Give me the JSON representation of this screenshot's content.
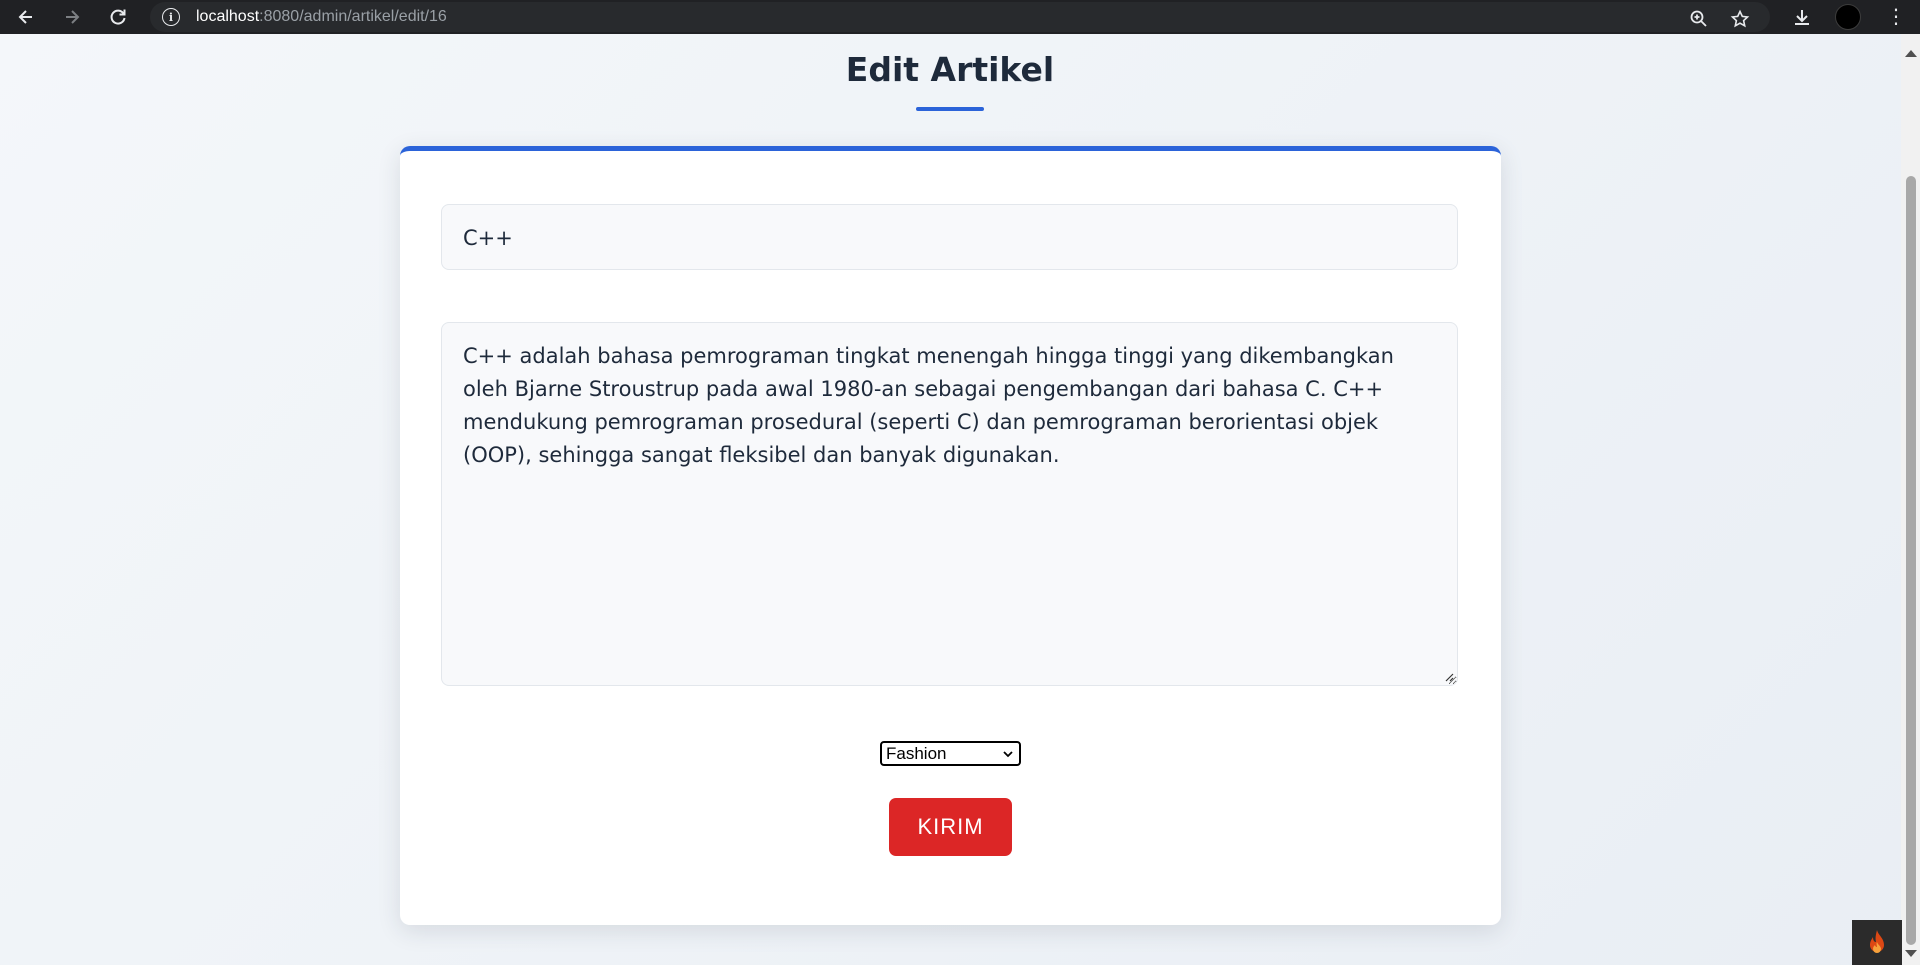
{
  "browser": {
    "url_host": "localhost",
    "url_path": ":8080/admin/artikel/edit/16",
    "icons": [
      "back-arrow-icon",
      "forward-arrow-icon",
      "reload-icon",
      "site-info-icon",
      "zoom-icon",
      "bookmark-star-icon",
      "download-icon",
      "profile-avatar",
      "menu-dots-icon"
    ]
  },
  "page": {
    "title": "Edit Artikel"
  },
  "form": {
    "title_value": "C++",
    "content_value": "C++ adalah bahasa pemrograman tingkat menengah hingga tinggi yang dikembangkan oleh Bjarne Stroustrup pada awal 1980-an sebagai pengembangan dari bahasa C. C++ mendukung pemrograman prosedural (seperti C) dan pemrograman berorientasi objek (OOP), sehingga sangat fleksibel dan banyak digunakan.",
    "category_selected": "Fashion",
    "submit_label": "KIRIM"
  },
  "colors": {
    "accent": "#2b63d9",
    "submit": "#dc2626",
    "title_text": "#1e2a3b"
  }
}
